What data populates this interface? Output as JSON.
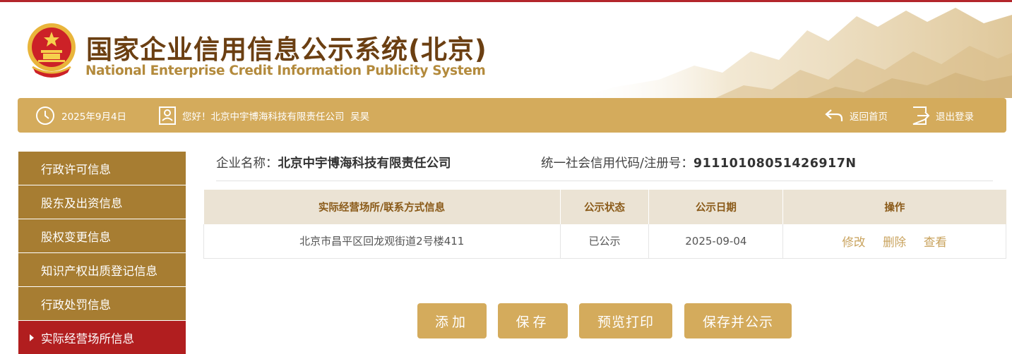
{
  "header": {
    "title_cn": "国家企业信用信息公示系统(北京)",
    "title_en": "National Enterprise Credit Information Publicity System"
  },
  "bar": {
    "date": "2025年9月4日",
    "greeting": "您好！北京中宇博海科技有限责任公司  吴昊",
    "home_label": "返回首页",
    "logout_label": "退出登录"
  },
  "sidebar": {
    "items": [
      {
        "label": "行政许可信息"
      },
      {
        "label": "股东及出资信息"
      },
      {
        "label": "股权变更信息"
      },
      {
        "label": "知识产权出质登记信息"
      },
      {
        "label": "行政处罚信息"
      },
      {
        "label": "实际经营场所信息",
        "active": true
      }
    ]
  },
  "company": {
    "name_label": "企业名称：",
    "name": "北京中宇博海科技有限责任公司",
    "code_label": "统一社会信用代码/注册号：",
    "code": "91110108051426917N"
  },
  "table": {
    "headers": [
      "实际经营场所/联系方式信息",
      "公示状态",
      "公示日期",
      "操作"
    ],
    "rows": [
      {
        "address": "北京市昌平区回龙观街道2号楼411",
        "status": "已公示",
        "date": "2025-09-04"
      }
    ],
    "actions": {
      "edit": "修改",
      "delete": "删除",
      "view": "查看"
    }
  },
  "buttons": {
    "add": "添加",
    "save": "保存",
    "preview": "预览打印",
    "save_publish": "保存并公示"
  },
  "colors": {
    "accent": "#d4ab5c",
    "sidebar": "#a77d32",
    "active": "#b11e1f",
    "title": "#6b3f12"
  }
}
